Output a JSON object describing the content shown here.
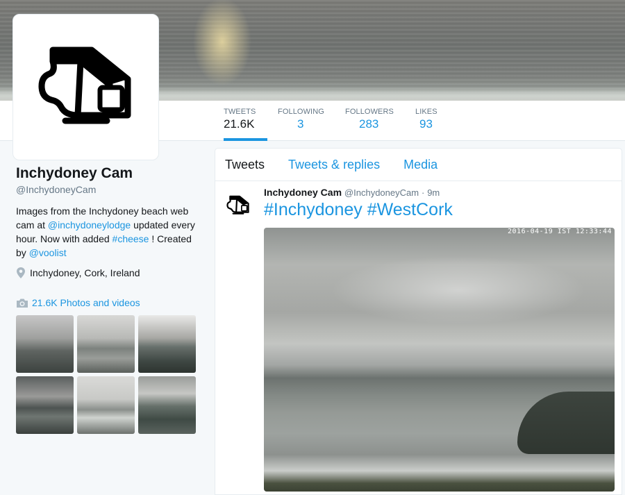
{
  "profile": {
    "name": "Inchydoney Cam",
    "handle": "@InchydoneyCam",
    "bio_pre": "Images from the Inchydoney beach web cam at ",
    "bio_mention": "@inchydoneylodge",
    "bio_mid": " updated every hour. Now with added ",
    "bio_hashtag": "#cheese",
    "bio_post": " ! Created by ",
    "bio_mention2": "@voolist",
    "location": "Inchydoney, Cork, Ireland",
    "photos_label": "21.6K Photos and videos",
    "location_icon": "map-pin-icon",
    "photos_icon": "camera-icon"
  },
  "stats": [
    {
      "label": "TWEETS",
      "value": "21.6K"
    },
    {
      "label": "FOLLOWING",
      "value": "3"
    },
    {
      "label": "FOLLOWERS",
      "value": "283"
    },
    {
      "label": "LIKES",
      "value": "93"
    }
  ],
  "tabs": [
    {
      "label": "Tweets"
    },
    {
      "label": "Tweets & replies"
    },
    {
      "label": "Media"
    }
  ],
  "tweet": {
    "name": "Inchydoney Cam",
    "handle": "@InchydoneyCam",
    "sep": "·",
    "time": "9m",
    "hashtag1": "#Inchydoney",
    "hashtag2": "#WestCork",
    "image_timestamp": "2016-04-19 IST 12:33:44"
  },
  "colors": {
    "accent": "#1b95e0",
    "text": "#14171a",
    "muted": "#657786",
    "background": "#f5f8fa"
  }
}
